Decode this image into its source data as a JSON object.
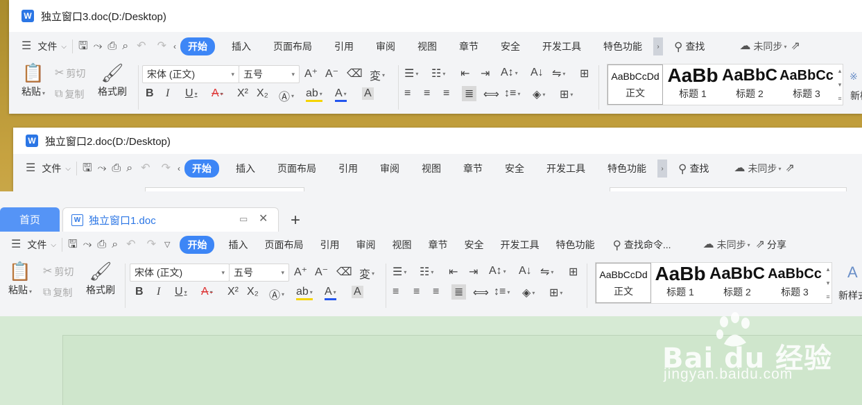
{
  "windows": {
    "win3": {
      "title": "独立窗口3.doc(D:/Desktop)"
    },
    "win2": {
      "title": "独立窗口2.doc(D:/Desktop)"
    },
    "win1": {
      "home_tab": "首页",
      "doc_tab": "独立窗口1.doc"
    }
  },
  "menu": {
    "file": "文件",
    "tabs": [
      "开始",
      "插入",
      "页面布局",
      "引用",
      "审阅",
      "视图",
      "章节",
      "安全",
      "开发工具",
      "特色功能"
    ],
    "search": "查找",
    "search_cmd": "查找命令...",
    "sync": "未同步",
    "share": "分享"
  },
  "ribbon": {
    "paste": "粘贴",
    "cut": "剪切",
    "copy": "复制",
    "format_painter": "格式刷",
    "font_name": "宋体 (正文)",
    "font_size": "五号",
    "styles": [
      {
        "preview": "AaBbCcDd",
        "caption": "正文"
      },
      {
        "preview": "AaBb",
        "caption": "标题 1"
      },
      {
        "preview": "AaBbC",
        "caption": "标题 2"
      },
      {
        "preview": "AaBbCc",
        "caption": "标题 3"
      }
    ],
    "new_style": "新样式"
  },
  "watermark": {
    "brand": "Bai du 经验",
    "url": "jingyan.baidu.com"
  },
  "colors": {
    "accent": "#3d86f6",
    "tab_active": "#5594f6",
    "doc_bg": "#d6ead4",
    "desktop": "#c7a341"
  }
}
